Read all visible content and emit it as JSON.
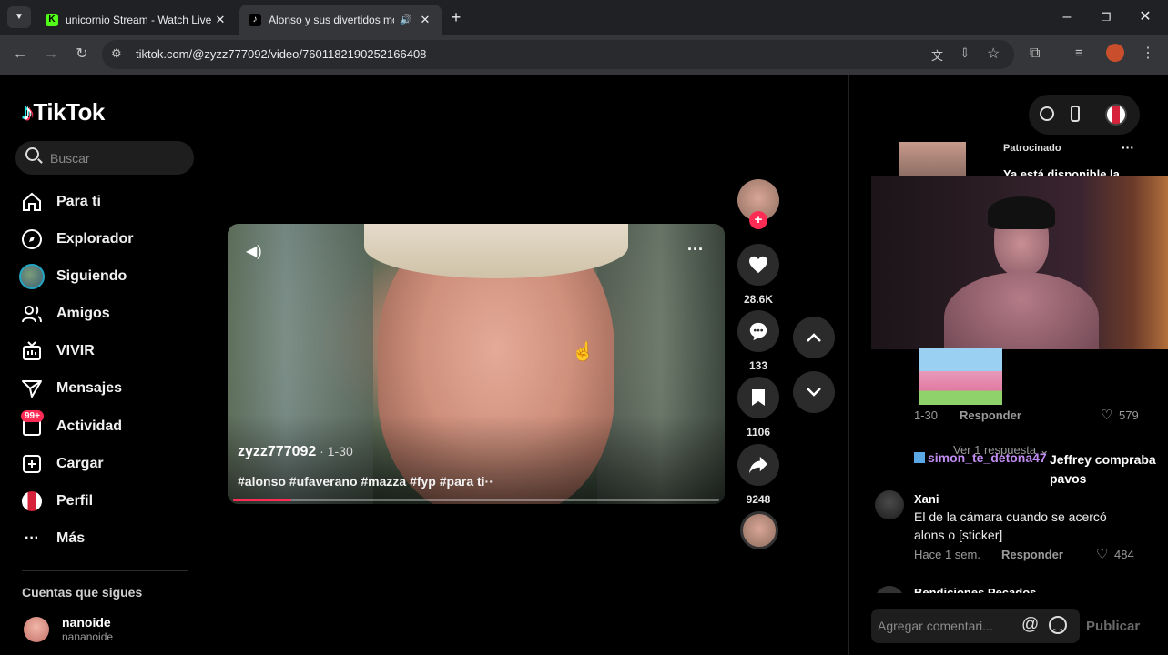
{
  "browser": {
    "tabs": [
      {
        "title": "unicornio Stream - Watch Live o",
        "favicon": "kick-icon"
      },
      {
        "title": "Alonso y sus divertidos mo",
        "favicon": "tiktok-icon"
      }
    ],
    "url": "tiktok.com/@zyzz777092/video/7601182190252166408"
  },
  "sidebar": {
    "brand": "TikTok",
    "search_placeholder": "Buscar",
    "nav": [
      {
        "label": "Para ti",
        "icon": "home-icon"
      },
      {
        "label": "Explorador",
        "icon": "compass-icon"
      },
      {
        "label": "Siguiendo",
        "icon": "avatar-icon"
      },
      {
        "label": "Amigos",
        "icon": "friends-icon"
      },
      {
        "label": "VIVIR",
        "icon": "live-tv-icon"
      },
      {
        "label": "Mensajes",
        "icon": "send-icon"
      },
      {
        "label": "Actividad",
        "icon": "inbox-icon",
        "badge": "99+"
      },
      {
        "label": "Cargar",
        "icon": "plus-square-icon"
      },
      {
        "label": "Perfil",
        "icon": "profile-avatar-icon"
      },
      {
        "label": "Más",
        "icon": "more-dots-icon"
      }
    ],
    "following_title": "Cuentas que sigues",
    "following": {
      "name": "nanoide",
      "handle": "nananoide"
    }
  },
  "video": {
    "author": "zyzz777092",
    "date": " · 1-30",
    "caption": "#alonso #ufaverano #mazza #fyp #para ti··",
    "progress": 0.12
  },
  "actions": {
    "likes": "28.6K",
    "comments": "133",
    "saves": "1106",
    "shares": "9248"
  },
  "comments_panel": {
    "sponsored_label": "Patrocinado",
    "sponsored_text": "Ya está disponible la",
    "reply1_meta_date": "1-30",
    "reply_label": "Responder",
    "reply1_likes": "579",
    "view_replies": "Ver 1 respuesta",
    "comment2_name": "Xani",
    "comment2_text": "El de la cámara cuando se acercó alons o [sticker]",
    "comment2_date": "Hace 1 sem.",
    "comment2_likes": "484",
    "comment3_name": "Bendiciones Pecados",
    "input_placeholder": "Agregar comentari...",
    "publish_label": "Publicar"
  },
  "stream_overlay": {
    "chat_user": "simon_te_detona47",
    "chat_text": "Jeffrey compraba pavos"
  },
  "colors": {
    "accent": "#fe2c55",
    "chrome_bg": "#202124",
    "kick_green": "#53fc18"
  }
}
